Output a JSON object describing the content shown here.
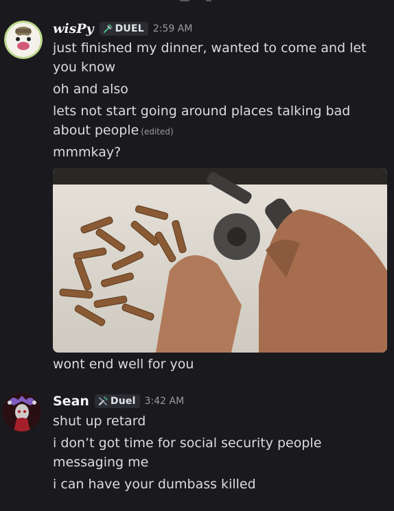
{
  "messages": [
    {
      "username": "wisPy",
      "tag": {
        "label": "DUEL",
        "icon": "sword-check-icon"
      },
      "timestamp": "2:59 AM",
      "lines": [
        "just finished my dinner, wanted to come and let you know",
        "oh and also",
        "lets not start going around places talking bad about people",
        "mmmkay?"
      ],
      "edited_label": "(edited)",
      "after_image": "wont end well for you"
    },
    {
      "username": "Sean",
      "tag": {
        "label": "Duel",
        "icon": "sword-check-icon"
      },
      "timestamp": "3:42 AM",
      "lines": [
        "shut up retard",
        "i don’t got time for social security people messaging me",
        "i can have your dumbass killed"
      ]
    }
  ],
  "colors": {
    "background": "#1a1a1e",
    "username": "#f2f3f5",
    "message_text": "#dcdde1",
    "timestamp": "#9a9ba3",
    "tag_bg": "#2b2d33",
    "tag_icon": "#43b581"
  }
}
